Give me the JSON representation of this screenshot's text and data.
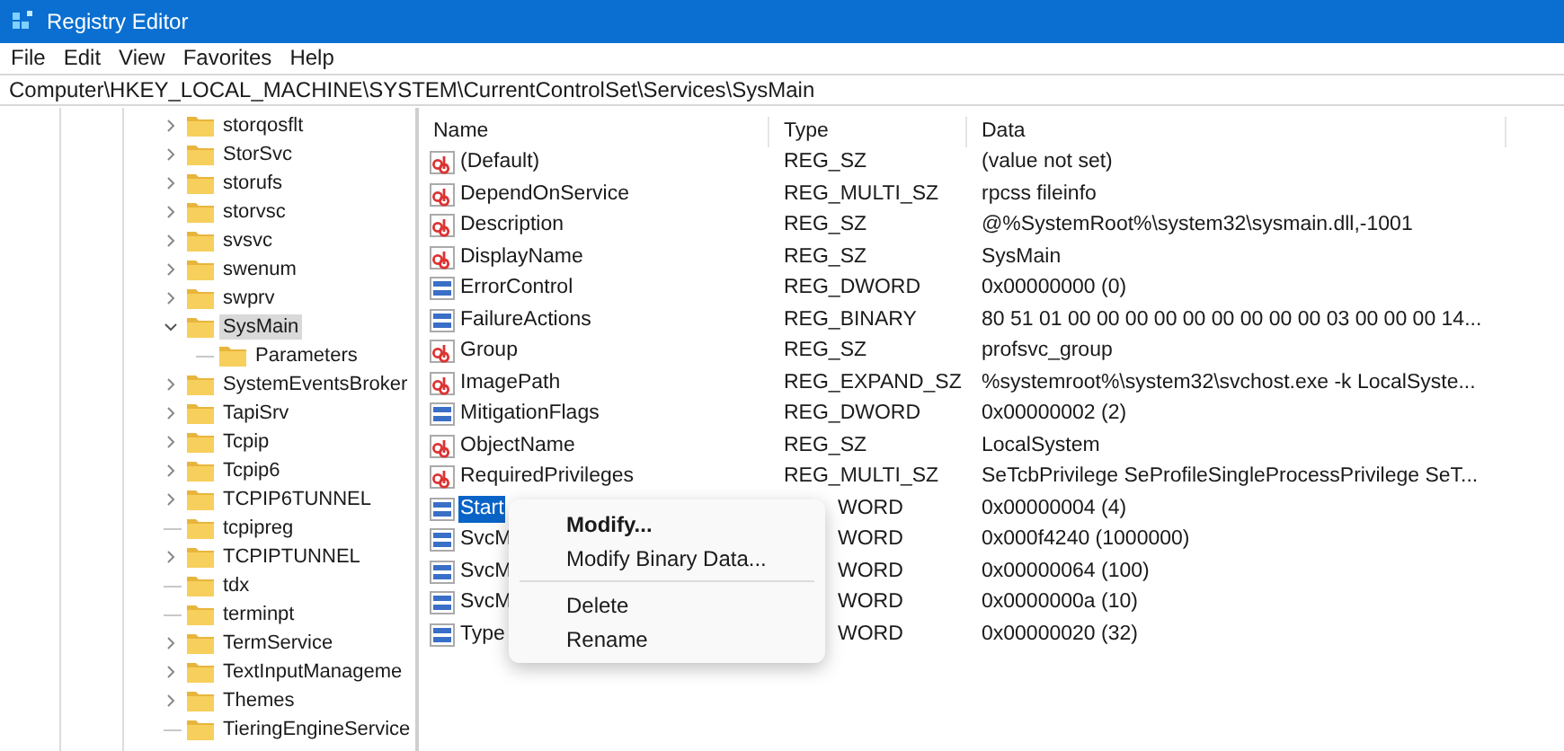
{
  "window": {
    "title": "Registry Editor"
  },
  "menu": [
    "File",
    "Edit",
    "View",
    "Favorites",
    "Help"
  ],
  "address": "Computer\\HKEY_LOCAL_MACHINE\\SYSTEM\\CurrentControlSet\\Services\\SysMain",
  "tree": [
    {
      "label": "storqosflt",
      "has_subkeys": true,
      "expanded": false,
      "selected": false
    },
    {
      "label": "StorSvc",
      "has_subkeys": true,
      "expanded": false,
      "selected": false
    },
    {
      "label": "storufs",
      "has_subkeys": true,
      "expanded": false,
      "selected": false
    },
    {
      "label": "storvsc",
      "has_subkeys": true,
      "expanded": false,
      "selected": false
    },
    {
      "label": "svsvc",
      "has_subkeys": true,
      "expanded": false,
      "selected": false
    },
    {
      "label": "swenum",
      "has_subkeys": true,
      "expanded": false,
      "selected": false
    },
    {
      "label": "swprv",
      "has_subkeys": true,
      "expanded": false,
      "selected": false
    },
    {
      "label": "SysMain",
      "has_subkeys": true,
      "expanded": true,
      "selected": true,
      "children": [
        {
          "label": "Parameters",
          "has_subkeys": false,
          "expanded": false,
          "selected": false
        }
      ]
    },
    {
      "label": "SystemEventsBroker",
      "has_subkeys": true,
      "expanded": false,
      "selected": false
    },
    {
      "label": "TapiSrv",
      "has_subkeys": true,
      "expanded": false,
      "selected": false
    },
    {
      "label": "Tcpip",
      "has_subkeys": true,
      "expanded": false,
      "selected": false
    },
    {
      "label": "Tcpip6",
      "has_subkeys": true,
      "expanded": false,
      "selected": false
    },
    {
      "label": "TCPIP6TUNNEL",
      "has_subkeys": true,
      "expanded": false,
      "selected": false
    },
    {
      "label": "tcpipreg",
      "has_subkeys": false,
      "expanded": false,
      "selected": false
    },
    {
      "label": "TCPIPTUNNEL",
      "has_subkeys": true,
      "expanded": false,
      "selected": false
    },
    {
      "label": "tdx",
      "has_subkeys": false,
      "expanded": false,
      "selected": false
    },
    {
      "label": "terminpt",
      "has_subkeys": false,
      "expanded": false,
      "selected": false
    },
    {
      "label": "TermService",
      "has_subkeys": true,
      "expanded": false,
      "selected": false
    },
    {
      "label": "TextInputManageme",
      "has_subkeys": true,
      "expanded": false,
      "selected": false
    },
    {
      "label": "Themes",
      "has_subkeys": true,
      "expanded": false,
      "selected": false
    },
    {
      "label": "TieringEngineService",
      "has_subkeys": false,
      "expanded": false,
      "selected": false
    }
  ],
  "table": {
    "columns": [
      "Name",
      "Type",
      "Data"
    ],
    "rows": [
      {
        "kind": "string",
        "name": "(Default)",
        "type": "REG_SZ",
        "data": "(value not set)",
        "selected": false,
        "covered": false
      },
      {
        "kind": "string",
        "name": "DependOnService",
        "type": "REG_MULTI_SZ",
        "data": "rpcss fileinfo",
        "selected": false,
        "covered": false
      },
      {
        "kind": "string",
        "name": "Description",
        "type": "REG_SZ",
        "data": "@%SystemRoot%\\system32\\sysmain.dll,-1001",
        "selected": false,
        "covered": false
      },
      {
        "kind": "string",
        "name": "DisplayName",
        "type": "REG_SZ",
        "data": "SysMain",
        "selected": false,
        "covered": false
      },
      {
        "kind": "binary",
        "name": "ErrorControl",
        "type": "REG_DWORD",
        "data": "0x00000000 (0)",
        "selected": false,
        "covered": false
      },
      {
        "kind": "binary",
        "name": "FailureActions",
        "type": "REG_BINARY",
        "data": "80 51 01 00 00 00 00 00 00 00 00 00 03 00 00 00 14...",
        "selected": false,
        "covered": false
      },
      {
        "kind": "string",
        "name": "Group",
        "type": "REG_SZ",
        "data": "profsvc_group",
        "selected": false,
        "covered": false
      },
      {
        "kind": "string",
        "name": "ImagePath",
        "type": "REG_EXPAND_SZ",
        "data": "%systemroot%\\system32\\svchost.exe -k LocalSyste...",
        "selected": false,
        "covered": false
      },
      {
        "kind": "binary",
        "name": "MitigationFlags",
        "type": "REG_DWORD",
        "data": "0x00000002 (2)",
        "selected": false,
        "covered": false
      },
      {
        "kind": "string",
        "name": "ObjectName",
        "type": "REG_SZ",
        "data": "LocalSystem",
        "selected": false,
        "covered": false
      },
      {
        "kind": "string",
        "name": "RequiredPrivileges",
        "type": "REG_MULTI_SZ",
        "data": "SeTcbPrivilege SeProfileSingleProcessPrivilege SeT...",
        "selected": false,
        "covered": false
      },
      {
        "kind": "binary",
        "name": "Start",
        "type": "WORD",
        "data": "0x00000004 (4)",
        "selected": true,
        "covered": true
      },
      {
        "kind": "binary",
        "name": "SvcM",
        "type": "WORD",
        "data": "0x000f4240 (1000000)",
        "selected": false,
        "covered": true
      },
      {
        "kind": "binary",
        "name": "SvcM",
        "type": "WORD",
        "data": "0x00000064 (100)",
        "selected": false,
        "covered": true
      },
      {
        "kind": "binary",
        "name": "SvcM",
        "type": "WORD",
        "data": "0x0000000a (10)",
        "selected": false,
        "covered": true
      },
      {
        "kind": "binary",
        "name": "Type",
        "type": "WORD",
        "data": "0x00000020 (32)",
        "selected": false,
        "covered": true
      }
    ]
  },
  "context_menu": {
    "items": [
      {
        "kind": "item",
        "label": "Modify...",
        "default": true
      },
      {
        "kind": "item",
        "label": "Modify Binary Data...",
        "default": false
      },
      {
        "kind": "separator"
      },
      {
        "kind": "item",
        "label": "Delete",
        "default": false
      },
      {
        "kind": "item",
        "label": "Rename",
        "default": false
      }
    ]
  }
}
